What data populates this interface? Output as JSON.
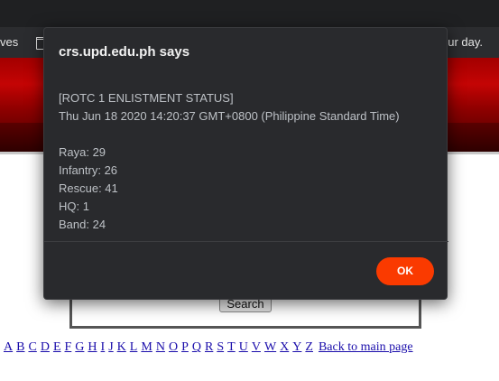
{
  "bookmarks_bar": {
    "left_text": "ves",
    "right_text": "ur day."
  },
  "page": {
    "search_button_label": "Search",
    "alphabet_links": [
      "A",
      "B",
      "C",
      "D",
      "E",
      "F",
      "G",
      "H",
      "I",
      "J",
      "K",
      "L",
      "M",
      "N",
      "O",
      "P",
      "Q",
      "R",
      "S",
      "T",
      "U",
      "V",
      "W",
      "X",
      "Y",
      "Z"
    ],
    "back_link": "Back to main page",
    "colors": {
      "banner": "#c40404",
      "link": "#1a0dab"
    }
  },
  "dialog": {
    "title": "crs.upd.edu.ph says",
    "heading": "[ROTC 1 ENLISTMENT STATUS]",
    "timestamp": "Thu Jun 18 2020 14:20:37 GMT+0800 (Philippine Standard Time)",
    "counts": [
      "Raya: 29",
      "Infantry: 26",
      "Rescue: 41",
      "HQ: 1",
      "Band: 24"
    ],
    "ok_label": "OK",
    "colors": {
      "background": "#292a2d",
      "ok_button": "#fa3a00"
    }
  }
}
